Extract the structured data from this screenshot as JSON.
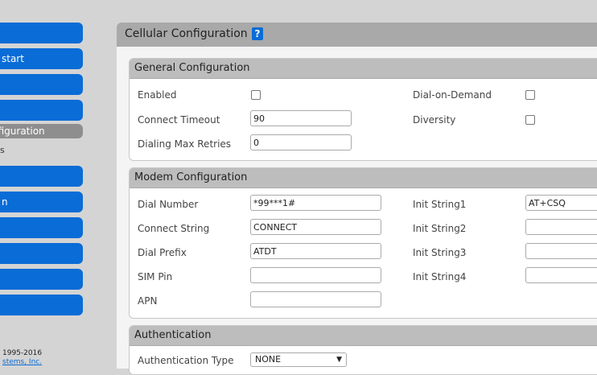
{
  "sidebar": {
    "items": [
      {
        "label": ""
      },
      {
        "label": "start"
      },
      {
        "label": ""
      },
      {
        "label": ""
      },
      {
        "label": "nfiguration"
      },
      {
        "label": "s"
      },
      {
        "label": ""
      },
      {
        "label": "n"
      },
      {
        "label": ""
      },
      {
        "label": ""
      },
      {
        "label": ""
      },
      {
        "label": ""
      }
    ],
    "copyright": "1995-2016",
    "company": "stems, Inc."
  },
  "main": {
    "title": "Cellular Configuration",
    "help": "?"
  },
  "general": {
    "title": "General Configuration",
    "enabled_label": "Enabled",
    "dial_on_demand_label": "Dial-on-Demand",
    "connect_timeout_label": "Connect Timeout",
    "connect_timeout_value": "90",
    "diversity_label": "Diversity",
    "dialing_max_retries_label": "Dialing Max Retries",
    "dialing_max_retries_value": "0"
  },
  "modem": {
    "title": "Modem Configuration",
    "dial_number_label": "Dial Number",
    "dial_number_value": "*99***1#",
    "connect_string_label": "Connect String",
    "connect_string_value": "CONNECT",
    "dial_prefix_label": "Dial Prefix",
    "dial_prefix_value": "ATDT",
    "sim_pin_label": "SIM Pin",
    "sim_pin_value": "",
    "apn_label": "APN",
    "apn_value": "",
    "init1_label": "Init String1",
    "init1_value": "AT+CSQ",
    "init2_label": "Init String2",
    "init2_value": "",
    "init3_label": "Init String3",
    "init3_value": "",
    "init4_label": "Init String4",
    "init4_value": ""
  },
  "auth": {
    "title": "Authentication",
    "type_label": "Authentication Type",
    "type_value": "NONE"
  }
}
